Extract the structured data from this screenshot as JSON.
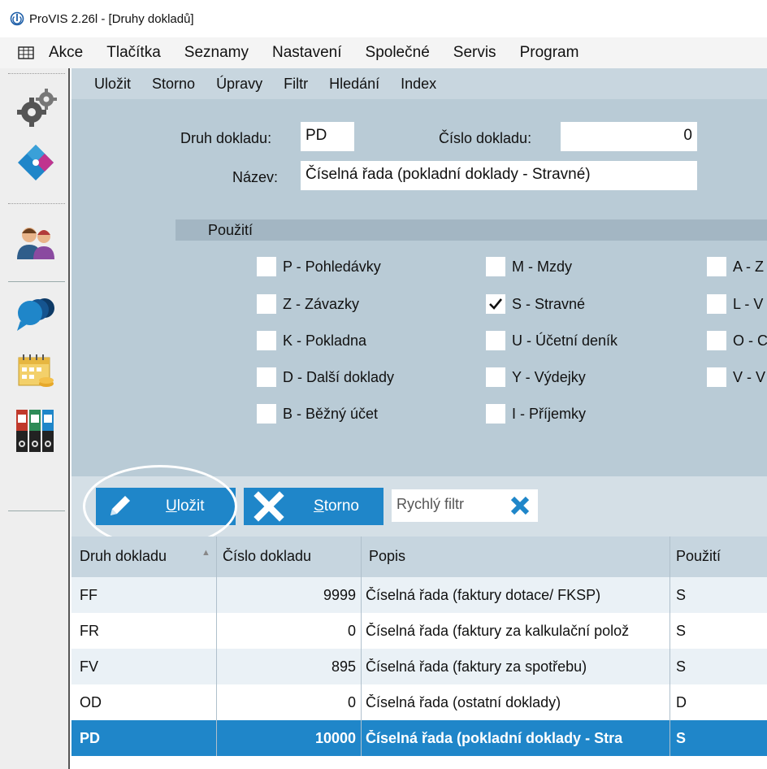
{
  "window": {
    "title": "ProVIS 2.26l - [Druhy dokladů]"
  },
  "menu": [
    "Akce",
    "Tlačítka",
    "Seznamy",
    "Nastavení",
    "Společné",
    "Servis",
    "Program"
  ],
  "submenu": [
    "Uložit",
    "Storno",
    "Úpravy",
    "Filtr",
    "Hledání",
    "Index"
  ],
  "form": {
    "druh_label": "Druh dokladu:",
    "druh_value": "PD",
    "cislo_label": "Číslo dokladu:",
    "cislo_value": "0",
    "nazev_label": "Název:",
    "nazev_value": "Číselná řada (pokladní doklady - Stravné)"
  },
  "usage": {
    "header": "Použití",
    "col1": [
      {
        "label": "P - Pohledávky",
        "checked": false
      },
      {
        "label": "Z - Závazky",
        "checked": false
      },
      {
        "label": "K - Pokladna",
        "checked": false
      },
      {
        "label": "D - Další doklady",
        "checked": false
      },
      {
        "label": "B - Běžný účet",
        "checked": false
      }
    ],
    "col2": [
      {
        "label": "M - Mzdy",
        "checked": false
      },
      {
        "label": "S - Stravné",
        "checked": true
      },
      {
        "label": "U - Účetní deník",
        "checked": false
      },
      {
        "label": "Y - Výdejky",
        "checked": false
      },
      {
        "label": "I - Příjemky",
        "checked": false
      }
    ],
    "col3": [
      {
        "label": "A - Z",
        "checked": false
      },
      {
        "label": "L - V",
        "checked": false
      },
      {
        "label": "O - C",
        "checked": false
      },
      {
        "label": "V - V",
        "checked": false
      }
    ]
  },
  "buttons": {
    "save_prefix": "U",
    "save_rest": "ložit",
    "cancel_prefix": "S",
    "cancel_rest": "torno",
    "quick_filter_placeholder": "Rychlý filtr"
  },
  "table": {
    "columns": [
      "Druh dokladu",
      "Číslo dokladu",
      "Popis",
      "Použití"
    ],
    "rows": [
      {
        "druh": "FF",
        "cislo": "9999",
        "popis": "Číselná řada (faktury dotace/ FKSP)",
        "pouziti": "S"
      },
      {
        "druh": "FR",
        "cislo": "0",
        "popis": "Číselná řada (faktury za kalkulační polož",
        "pouziti": "S"
      },
      {
        "druh": "FV",
        "cislo": "895",
        "popis": "Číselná řada (faktury za spotřebu)",
        "pouziti": "S"
      },
      {
        "druh": "OD",
        "cislo": "0",
        "popis": "Číselná řada (ostatní doklady)",
        "pouziti": "D"
      },
      {
        "druh": "PD",
        "cislo": "10000",
        "popis": "Číselná řada (pokladní doklady - Stra",
        "pouziti": "S"
      }
    ],
    "selected_index": 4
  }
}
